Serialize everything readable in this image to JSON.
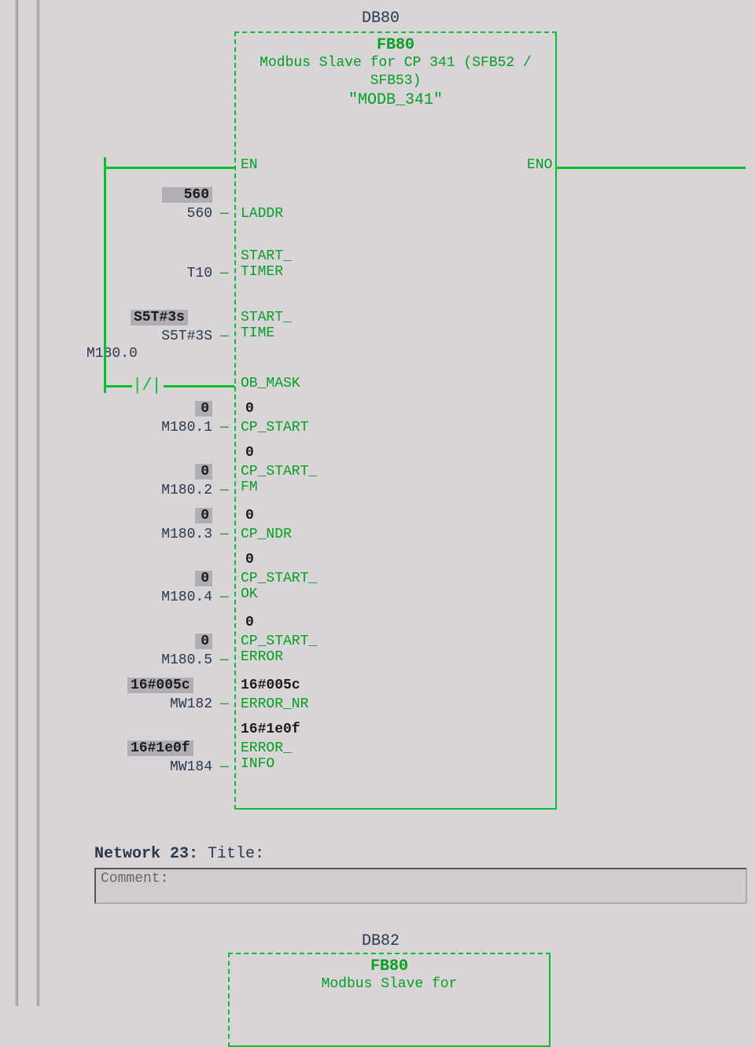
{
  "block1": {
    "db": "DB80",
    "fb": "FB80",
    "desc": "Modbus Slave for CP 341 (SFB52 / SFB53)",
    "name": "\"MODB_341\"",
    "en": "EN",
    "eno": "ENO",
    "pins": {
      "laddr": {
        "label": "LADDR",
        "addr": "560",
        "online": "560"
      },
      "start_timer": {
        "label": "START_\nTIMER",
        "addr": "T10"
      },
      "start_time": {
        "label": "START_\nTIME",
        "addr": "S5T#3S",
        "online": "S5T#3s"
      },
      "ob_mask": {
        "label": "OB_MASK",
        "addr": "M180.0"
      },
      "cp_start": {
        "label": "CP_START",
        "addr": "M180.1",
        "online": "0",
        "inside_online": "0"
      },
      "cp_start_fm": {
        "label": "CP_START_\nFM",
        "addr": "M180.2",
        "online": "0",
        "inside_online": "0"
      },
      "cp_ndr": {
        "label": "CP_NDR",
        "addr": "M180.3",
        "online": "0",
        "inside_online": "0"
      },
      "cp_start_ok": {
        "label": "CP_START_\nOK",
        "addr": "M180.4",
        "online": "0",
        "inside_online": "0"
      },
      "cp_start_err": {
        "label": "CP_START_\nERROR",
        "addr": "M180.5",
        "online": "0",
        "inside_online": "0"
      },
      "error_nr": {
        "label": "ERROR_NR",
        "addr": "MW182",
        "online": "16#005c",
        "inside_online": "16#005c"
      },
      "error_info": {
        "label": "ERROR_\nINFO",
        "addr": "MW184",
        "online": "16#1e0f",
        "inside_online": "16#1e0f"
      }
    }
  },
  "network": {
    "label": "Network 23:",
    "title": "Title:",
    "comment_label": "Comment:"
  },
  "block2": {
    "db": "DB82",
    "fb": "FB80",
    "desc": "Modbus Slave for"
  }
}
